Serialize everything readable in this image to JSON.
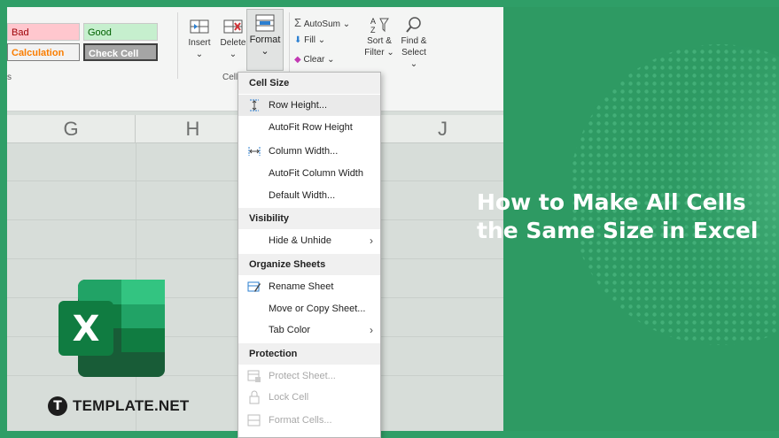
{
  "ribbon": {
    "styles": {
      "bad": "Bad",
      "good": "Good",
      "calculation": "Calculation",
      "check_cell": "Check Cell"
    },
    "cells_group": {
      "insert": "Insert",
      "delete": "Delete",
      "format": "Format",
      "group_label": "Cell"
    },
    "editing": {
      "autosum": "AutoSum",
      "fill": "Fill",
      "clear": "Clear",
      "sort_filter_1": "Sort &",
      "sort_filter_2": "Filter",
      "find_select_1": "Find &",
      "find_select_2": "Select"
    },
    "left_label": "s"
  },
  "columns": [
    "G",
    "H",
    "J"
  ],
  "menu": {
    "sections": {
      "cell_size": "Cell Size",
      "visibility": "Visibility",
      "organize": "Organize Sheets",
      "protection": "Protection"
    },
    "items": {
      "row_height": "Row Height...",
      "autofit_row": "AutoFit Row Height",
      "column_width": "Column Width...",
      "autofit_column": "AutoFit Column Width",
      "default_width": "Default Width...",
      "hide_unhide": "Hide & Unhide",
      "rename_sheet": "Rename Sheet",
      "move_copy": "Move or Copy Sheet...",
      "tab_color": "Tab Color",
      "protect_sheet": "Protect Sheet...",
      "lock_cell": "Lock Cell",
      "format_cells": "Format Cells..."
    }
  },
  "logo": {
    "letter": "X"
  },
  "brand": {
    "mark": "T",
    "name": "TEMPLATE.NET"
  },
  "headline": {
    "line1": "How to Make All Cells",
    "line2": "the Same Size in Excel"
  },
  "colors": {
    "brand_green": "#2f9e67",
    "excel_dark": "#107c41",
    "excel_light": "#33c481"
  }
}
